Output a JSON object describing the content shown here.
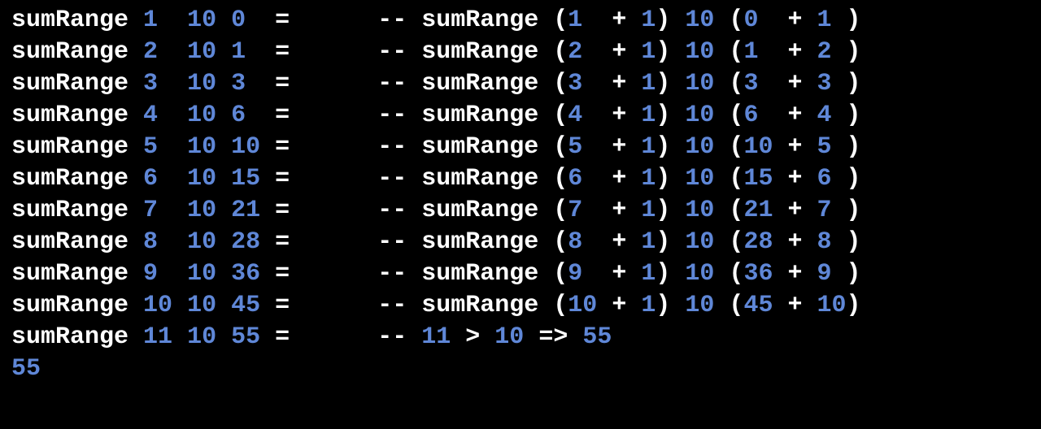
{
  "code": {
    "fn": "sumRange",
    "eq": "=",
    "dash": "--",
    "plus": "+",
    "lp": "(",
    "rp": ")",
    "gt": ">",
    "imp": "=>",
    "result": "55",
    "lines": [
      {
        "a": "1",
        "b": "10",
        "acc": "0",
        "na": "1",
        "nb": "1",
        "c": "10",
        "d1": "0",
        "d2": "1"
      },
      {
        "a": "2",
        "b": "10",
        "acc": "1",
        "na": "2",
        "nb": "1",
        "c": "10",
        "d1": "1",
        "d2": "2"
      },
      {
        "a": "3",
        "b": "10",
        "acc": "3",
        "na": "3",
        "nb": "1",
        "c": "10",
        "d1": "3",
        "d2": "3"
      },
      {
        "a": "4",
        "b": "10",
        "acc": "6",
        "na": "4",
        "nb": "1",
        "c": "10",
        "d1": "6",
        "d2": "4"
      },
      {
        "a": "5",
        "b": "10",
        "acc": "10",
        "na": "5",
        "nb": "1",
        "c": "10",
        "d1": "10",
        "d2": "5"
      },
      {
        "a": "6",
        "b": "10",
        "acc": "15",
        "na": "6",
        "nb": "1",
        "c": "10",
        "d1": "15",
        "d2": "6"
      },
      {
        "a": "7",
        "b": "10",
        "acc": "21",
        "na": "7",
        "nb": "1",
        "c": "10",
        "d1": "21",
        "d2": "7"
      },
      {
        "a": "8",
        "b": "10",
        "acc": "28",
        "na": "8",
        "nb": "1",
        "c": "10",
        "d1": "28",
        "d2": "8"
      },
      {
        "a": "9",
        "b": "10",
        "acc": "36",
        "na": "9",
        "nb": "1",
        "c": "10",
        "d1": "36",
        "d2": "9"
      },
      {
        "a": "10",
        "b": "10",
        "acc": "45",
        "na": "10",
        "nb": "1",
        "c": "10",
        "d1": "45",
        "d2": "10"
      }
    ],
    "last": {
      "a": "11",
      "b": "10",
      "acc": "55",
      "cmpL": "11",
      "cmpR": "10",
      "res": "55"
    }
  }
}
